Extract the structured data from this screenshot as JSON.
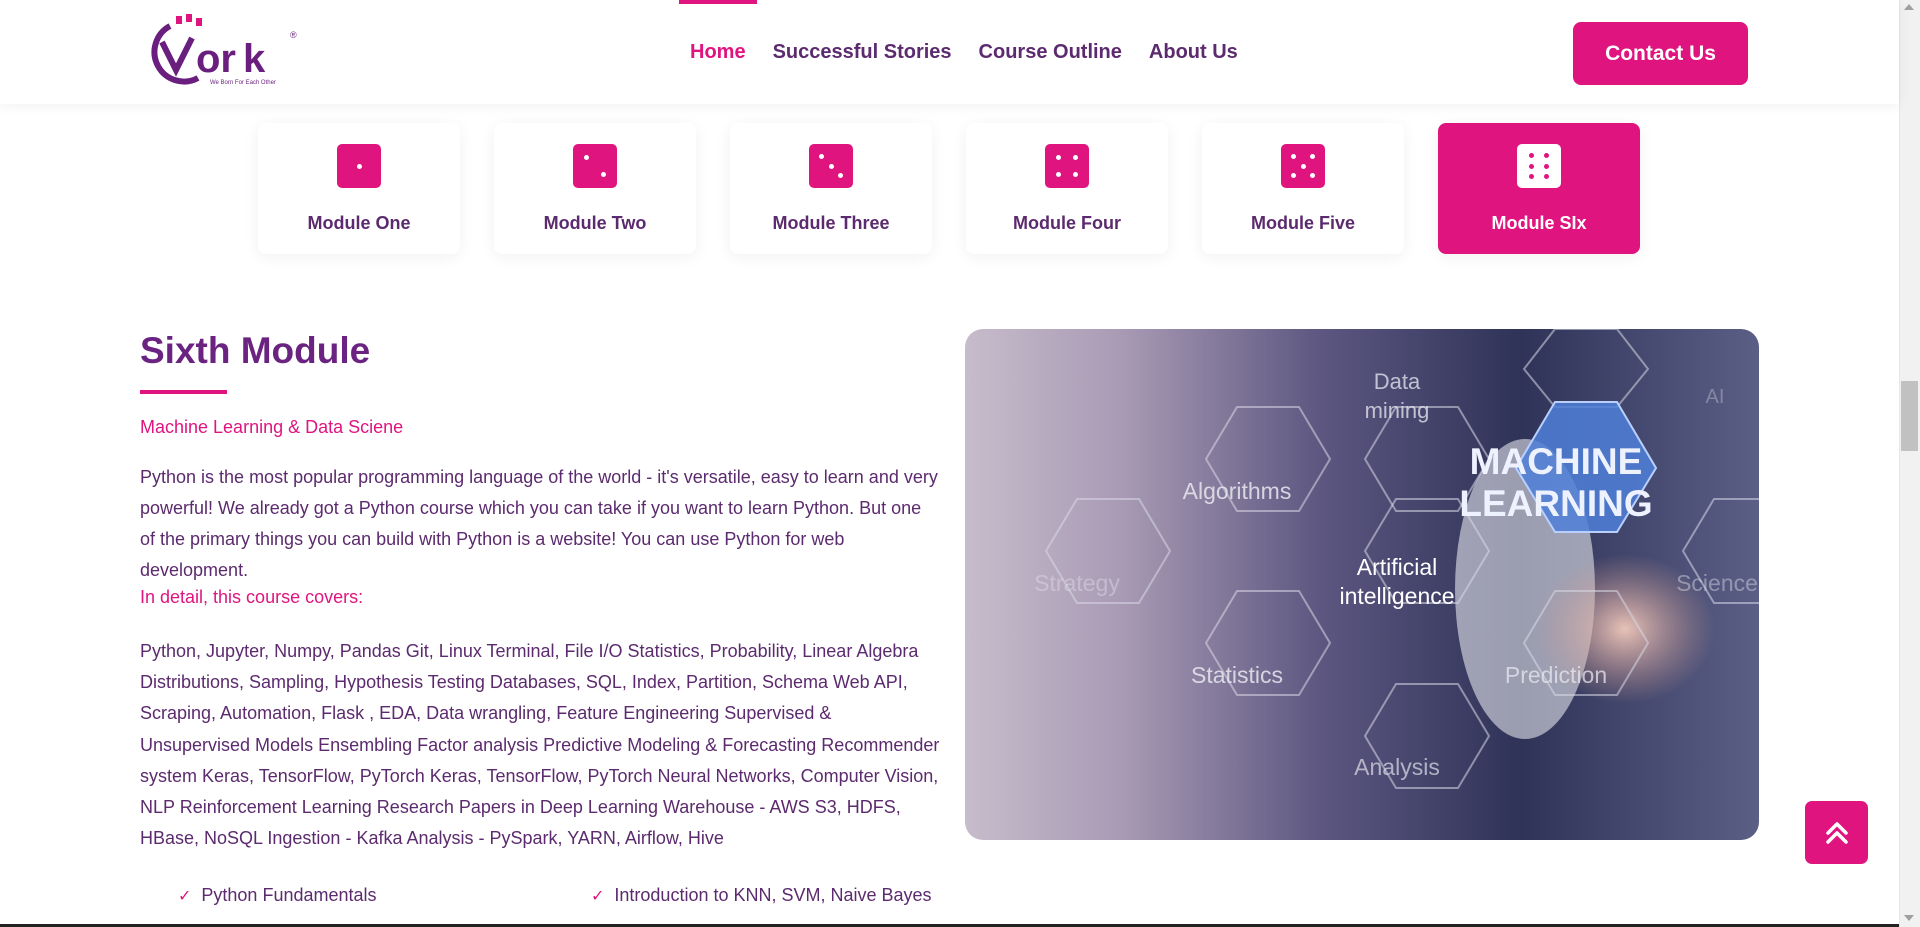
{
  "brand": {
    "logo_text": "Vork",
    "logo_tagline": "We Born For Each Other",
    "colors": {
      "accent": "#e0147f",
      "primary": "#5c2a6e"
    }
  },
  "nav": {
    "items": [
      {
        "label": "Home",
        "active": true
      },
      {
        "label": "Successful Stories",
        "active": false
      },
      {
        "label": "Course Outline",
        "active": false
      },
      {
        "label": "About Us",
        "active": false
      }
    ],
    "contact_label": "Contact Us"
  },
  "modules": [
    {
      "label": "Module One",
      "icon": "dice-one-icon",
      "active": false
    },
    {
      "label": "Module Two",
      "icon": "dice-two-icon",
      "active": false
    },
    {
      "label": "Module Three",
      "icon": "dice-three-icon",
      "active": false
    },
    {
      "label": "Module Four",
      "icon": "dice-four-icon",
      "active": false
    },
    {
      "label": "Module Five",
      "icon": "dice-five-icon",
      "active": false
    },
    {
      "label": "Module SIx",
      "icon": "dice-six-icon",
      "active": true
    }
  ],
  "content": {
    "title": "Sixth Module",
    "subtitle": "Machine Learning & Data Sciene",
    "paragraph": "Python is the most popular programming language of the world - it's versatile, easy to learn and very powerful! We already got a Python course which you can take if you want to learn Python. But one of the primary things you can build with Python is a website! You can use Python for web development.",
    "covers_label": "In detail, this course covers:",
    "topics": "Python, Jupyter, Numpy, Pandas Git, Linux Terminal, File I/O Statistics, Probability, Linear Algebra Distributions, Sampling, Hypothesis Testing Databases, SQL, Index, Partition, Schema Web API, Scraping, Automation, Flask , EDA, Data wrangling, Feature Engineering Supervised & Unsupervised Models Ensembling Factor analysis Predictive Modeling & Forecasting Recommender system Keras, TensorFlow, PyTorch Keras, TensorFlow, PyTorch Neural Networks, Computer Vision, NLP Reinforcement Learning Research Papers in Deep Learning Warehouse - AWS S3, HDFS, HBase, NoSQL Ingestion - Kafka Analysis - PySpark, YARN, Airflow, Hive",
    "bullets": [
      "Python Fundamentals",
      "Introduction to KNN, SVM, Naive Bayes"
    ]
  },
  "image": {
    "labels": {
      "data_mining_1": "Data",
      "data_mining_2": "mining",
      "ai": "AI",
      "algorithms": "Algorithms",
      "ml_1": "MACHINE",
      "ml_2": "LEARNING",
      "strategy": "Strategy",
      "artificial": "Artificial",
      "intelligence": "intelligence",
      "science": "Science",
      "statistics": "Statistics",
      "prediction": "Prediction",
      "analysis": "Analysis"
    }
  },
  "scroll_top_icon": "double-chevron-up-icon"
}
